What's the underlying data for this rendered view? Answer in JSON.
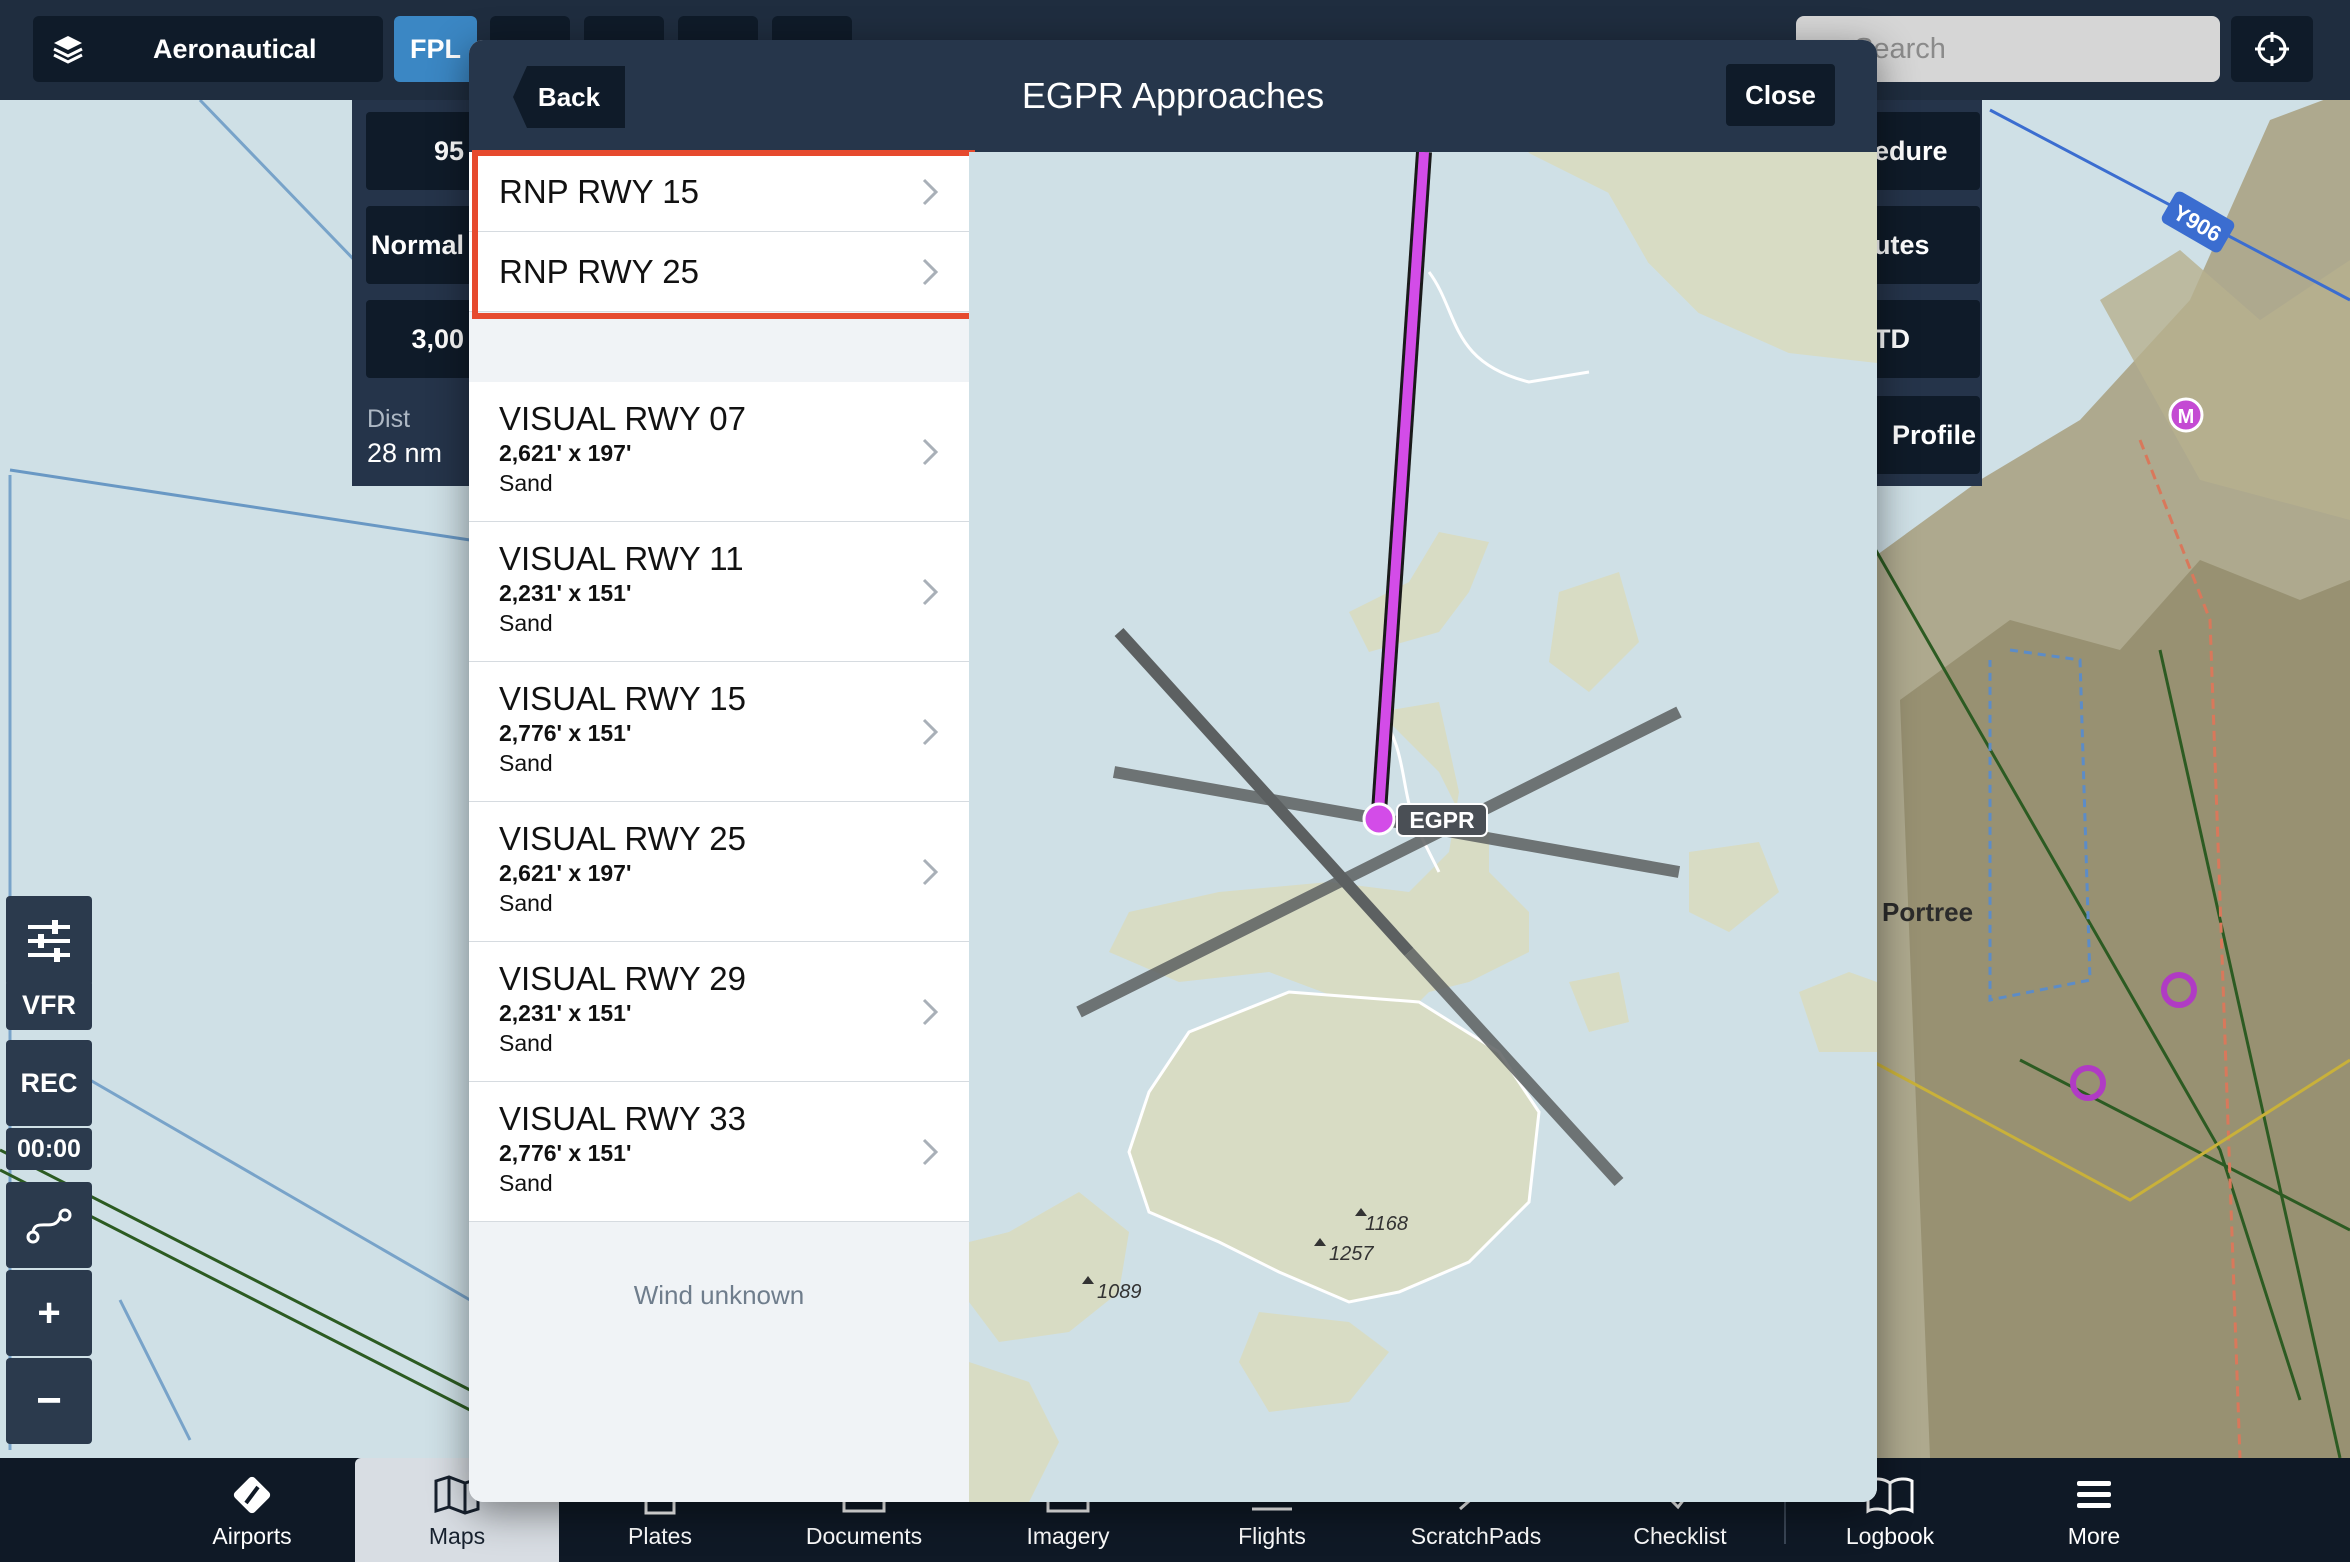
{
  "topbar": {
    "layers_label": "Aeronautical",
    "fpl_label": "FPL",
    "search_placeholder": "Search"
  },
  "fpl_panel": {
    "left_cells": [
      "95",
      "Normal",
      "3,00"
    ],
    "dist_label": "Dist",
    "dist_value": "28 nm",
    "right_cells": [
      "edure",
      "utes",
      "TD",
      "Profile"
    ]
  },
  "left_tools": {
    "vfr": "VFR",
    "rec": "REC",
    "timer": "00:00",
    "zoom_in": "+",
    "zoom_out": "−"
  },
  "map_labels": {
    "portree": "Portree",
    "airway": "Y906",
    "marker": "M"
  },
  "modal": {
    "title": "EGPR Approaches",
    "back": "Back",
    "close": "Close",
    "rnp_items": [
      {
        "title": "RNP RWY 15"
      },
      {
        "title": "RNP RWY 25"
      }
    ],
    "visual_items": [
      {
        "title": "VISUAL RWY 07",
        "dims": "2,621' x 197'",
        "surface": "Sand"
      },
      {
        "title": "VISUAL RWY 11",
        "dims": "2,231' x 151'",
        "surface": "Sand"
      },
      {
        "title": "VISUAL RWY 15",
        "dims": "2,776' x 151'",
        "surface": "Sand"
      },
      {
        "title": "VISUAL RWY 25",
        "dims": "2,621' x 197'",
        "surface": "Sand"
      },
      {
        "title": "VISUAL RWY 29",
        "dims": "2,231' x 151'",
        "surface": "Sand"
      },
      {
        "title": "VISUAL RWY 33",
        "dims": "2,776' x 151'",
        "surface": "Sand"
      }
    ],
    "wind": "Wind unknown",
    "airport_label": "EGPR",
    "elevations": [
      "1168",
      "1257",
      "1089"
    ]
  },
  "tabs": [
    {
      "label": "Airports",
      "icon": "airports-icon"
    },
    {
      "label": "Maps",
      "icon": "maps-icon"
    },
    {
      "label": "Plates",
      "icon": "plates-icon"
    },
    {
      "label": "Documents",
      "icon": "documents-icon"
    },
    {
      "label": "Imagery",
      "icon": "imagery-icon"
    },
    {
      "label": "Flights",
      "icon": "flights-icon"
    },
    {
      "label": "ScratchPads",
      "icon": "scratchpads-icon"
    },
    {
      "label": "Checklist",
      "icon": "checklist-icon"
    },
    {
      "label": "Logbook",
      "icon": "logbook-icon"
    },
    {
      "label": "More",
      "icon": "more-icon"
    }
  ],
  "colors": {
    "accent_blue": "#3b87c4",
    "highlight": "#e64a2e",
    "route": "#d34ce8",
    "dark_bar": "#0f1926"
  }
}
